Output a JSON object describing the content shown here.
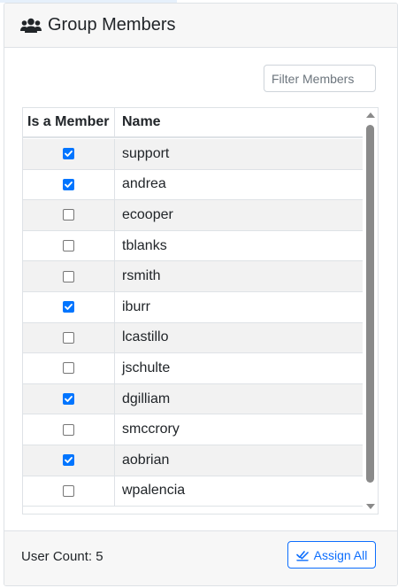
{
  "header": {
    "title": "Group Members",
    "icon": "users-icon"
  },
  "filter": {
    "placeholder": "Filter Members",
    "value": ""
  },
  "table": {
    "columns": [
      "Is a Member",
      "Name"
    ],
    "rows": [
      {
        "name": "support",
        "member": true
      },
      {
        "name": "andrea",
        "member": true
      },
      {
        "name": "ecooper",
        "member": false
      },
      {
        "name": "tblanks",
        "member": false
      },
      {
        "name": "rsmith",
        "member": false
      },
      {
        "name": "iburr",
        "member": true
      },
      {
        "name": "lcastillo",
        "member": false
      },
      {
        "name": "jschulte",
        "member": false
      },
      {
        "name": "dgilliam",
        "member": true
      },
      {
        "name": "smccrory",
        "member": false
      },
      {
        "name": "aobrian",
        "member": true
      },
      {
        "name": "wpalencia",
        "member": false
      }
    ]
  },
  "footer": {
    "count_text": "User Count: 5",
    "assign_label": "Assign All",
    "assign_icon": "double-check-icon"
  },
  "colors": {
    "accent": "#0d6efd",
    "checkbox": "#0075ff",
    "stripe": "#f2f2f2"
  }
}
